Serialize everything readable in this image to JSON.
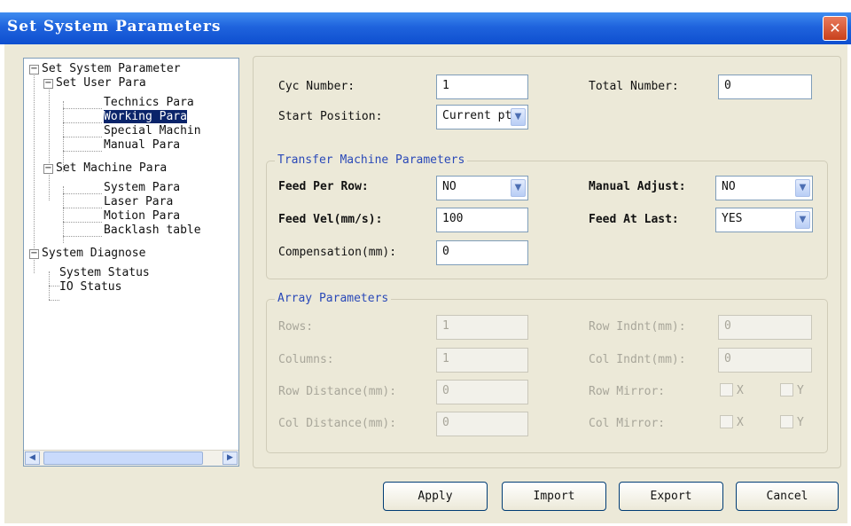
{
  "window": {
    "title": "Set System Parameters",
    "close_glyph": "✕"
  },
  "tree": {
    "items": [
      {
        "label": "Set System Parameter",
        "expanded": true
      },
      {
        "label": "Set User Para",
        "expanded": true
      },
      {
        "label": "Technics Para"
      },
      {
        "label": "Working Para",
        "selected": true
      },
      {
        "label": "Special Machin"
      },
      {
        "label": "Manual Para"
      },
      {
        "label": "Set Machine Para",
        "expanded": true
      },
      {
        "label": "System Para"
      },
      {
        "label": "Laser Para"
      },
      {
        "label": "Motion Para"
      },
      {
        "label": "Backlash table"
      },
      {
        "label": "System Diagnose",
        "expanded": true
      },
      {
        "label": "System Status"
      },
      {
        "label": "IO Status"
      }
    ],
    "expander_glyph": "−",
    "scroll_left": "◀",
    "scroll_right": "▶"
  },
  "form": {
    "cyc_number_label": "Cyc Number:",
    "cyc_number_value": "1",
    "total_number_label": "Total Number:",
    "total_number_value": "0",
    "start_position_label": "Start Position:",
    "start_position_value": "Current pt"
  },
  "transfer": {
    "title": "Transfer Machine Parameters",
    "feed_per_row_label": "Feed Per Row:",
    "feed_per_row_value": "NO",
    "manual_adjust_label": "Manual Adjust:",
    "manual_adjust_value": "NO",
    "feed_vel_label": "Feed Vel(mm/s):",
    "feed_vel_value": "100",
    "feed_at_last_label": "Feed At Last:",
    "feed_at_last_value": "YES",
    "compensation_label": "Compensation(mm):",
    "compensation_value": "0"
  },
  "array": {
    "title": "Array Parameters",
    "rows_label": "Rows:",
    "rows_value": "1",
    "row_indnt_label": "Row Indnt(mm):",
    "row_indnt_value": "0",
    "columns_label": "Columns:",
    "columns_value": "1",
    "col_indnt_label": "Col Indnt(mm):",
    "col_indnt_value": "0",
    "row_distance_label": "Row Distance(mm):",
    "row_distance_value": "0",
    "row_mirror_label": "Row Mirror:",
    "col_distance_label": "Col Distance(mm):",
    "col_distance_value": "0",
    "col_mirror_label": "Col Mirror:",
    "x_label": "X",
    "y_label": "Y"
  },
  "buttons": {
    "apply": "Apply",
    "import": "Import",
    "export": "Export",
    "cancel": "Cancel"
  },
  "dropdown_glyph": "▼"
}
